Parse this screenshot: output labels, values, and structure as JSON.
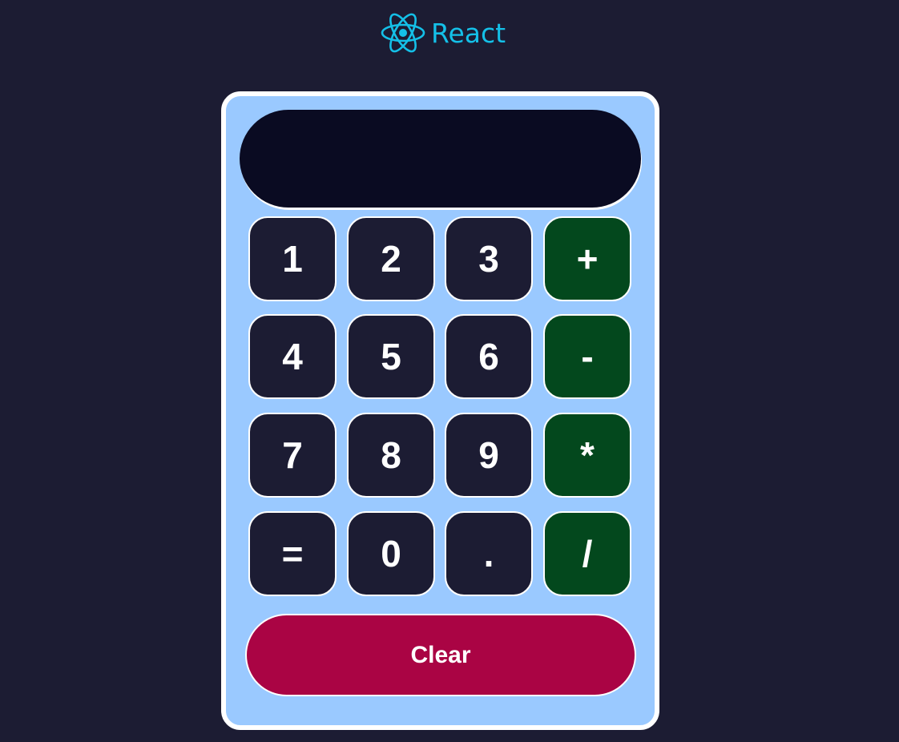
{
  "brand": {
    "icon": "react-atom-icon",
    "name": "React",
    "color": "#14c0e8"
  },
  "display": {
    "value": ""
  },
  "keys": {
    "k1": "1",
    "k2": "2",
    "k3": "3",
    "plus": "+",
    "k4": "4",
    "k5": "5",
    "k6": "6",
    "minus": "-",
    "k7": "7",
    "k8": "8",
    "k9": "9",
    "multiply": "*",
    "equals": "=",
    "k0": "0",
    "decimal": ".",
    "divide": "/"
  },
  "clear_label": "Clear",
  "colors": {
    "background": "#1c1c33",
    "panel": "#9ac9ff",
    "display": "#0a0b22",
    "digit_key": "#1c1c33",
    "operator_key": "#03481d",
    "clear_button": "#aa0444"
  }
}
